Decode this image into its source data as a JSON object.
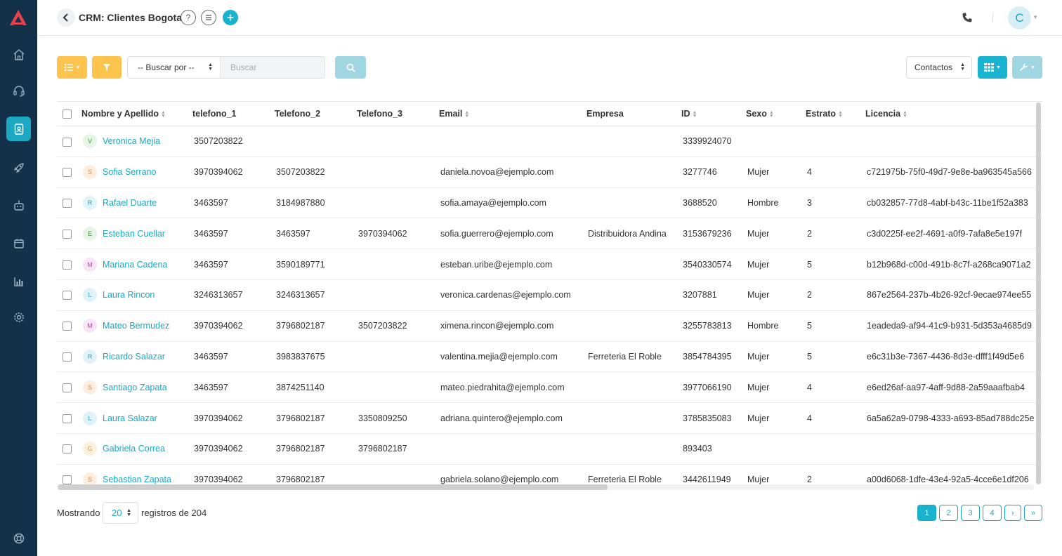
{
  "header": {
    "title": "CRM: Clientes Bogota",
    "help_icon": "?",
    "avatar_letter": "C"
  },
  "toolbar": {
    "search_by": "-- Buscar por --",
    "search_placeholder": "Buscar",
    "view_select": "Contactos"
  },
  "table": {
    "columns": [
      "Nombre y Apellido",
      "telefono_1",
      "Telefono_2",
      "Telefono_3",
      "Email",
      "Empresa",
      "ID",
      "Sexo",
      "Estrato",
      "Licencia"
    ],
    "rows": [
      {
        "initial": "V",
        "name": "Veronica Mejia",
        "t1": "3507203822",
        "t2": "",
        "t3": "",
        "email": "",
        "empresa": "",
        "id": "3339924070",
        "sexo": "",
        "estrato": "",
        "licencia": ""
      },
      {
        "initial": "S",
        "name": "Sofia Serrano",
        "t1": "3970394062",
        "t2": "3507203822",
        "t3": "",
        "email": "daniela.novoa@ejemplo.com",
        "empresa": "",
        "id": "3277746",
        "sexo": "Mujer",
        "estrato": "4",
        "licencia": "c721975b-75f0-49d7-9e8e-ba963545a566"
      },
      {
        "initial": "R",
        "name": "Rafael Duarte",
        "t1": "3463597",
        "t2": "3184987880",
        "t3": "",
        "email": "sofia.amaya@ejemplo.com",
        "empresa": "",
        "id": "3688520",
        "sexo": "Hombre",
        "estrato": "3",
        "licencia": "cb032857-77d8-4abf-b43c-11be1f52a383"
      },
      {
        "initial": "E",
        "name": "Esteban Cuellar",
        "t1": "3463597",
        "t2": "3463597",
        "t3": "3970394062",
        "email": "sofia.guerrero@ejemplo.com",
        "empresa": "Distribuidora Andina",
        "id": "3153679236",
        "sexo": "Mujer",
        "estrato": "2",
        "licencia": "c3d0225f-ee2f-4691-a0f9-7afa8e5e197f"
      },
      {
        "initial": "M",
        "name": "Mariana Cadena",
        "t1": "3463597",
        "t2": "3590189771",
        "t3": "",
        "email": "esteban.uribe@ejemplo.com",
        "empresa": "",
        "id": "3540330574",
        "sexo": "Mujer",
        "estrato": "5",
        "licencia": "b12b968d-c00d-491b-8c7f-a268ca9071a2"
      },
      {
        "initial": "L",
        "name": "Laura Rincon",
        "t1": "3246313657",
        "t2": "3246313657",
        "t3": "",
        "email": "veronica.cardenas@ejemplo.com",
        "empresa": "",
        "id": "3207881",
        "sexo": "Mujer",
        "estrato": "2",
        "licencia": "867e2564-237b-4b26-92cf-9ecae974ee55"
      },
      {
        "initial": "M",
        "name": "Mateo Bermudez",
        "t1": "3970394062",
        "t2": "3796802187",
        "t3": "3507203822",
        "email": "ximena.rincon@ejemplo.com",
        "empresa": "",
        "id": "3255783813",
        "sexo": "Hombre",
        "estrato": "5",
        "licencia": "1eadeda9-af94-41c9-b931-5d353a4685d9"
      },
      {
        "initial": "R",
        "name": "Ricardo Salazar",
        "t1": "3463597",
        "t2": "3983837675",
        "t3": "",
        "email": "valentina.mejia@ejemplo.com",
        "empresa": "Ferreteria El Roble",
        "id": "3854784395",
        "sexo": "Mujer",
        "estrato": "5",
        "licencia": "e6c31b3e-7367-4436-8d3e-dfff1f49d5e6"
      },
      {
        "initial": "S",
        "name": "Santiago Zapata",
        "t1": "3463597",
        "t2": "3874251140",
        "t3": "",
        "email": "mateo.piedrahita@ejemplo.com",
        "empresa": "",
        "id": "3977066190",
        "sexo": "Mujer",
        "estrato": "4",
        "licencia": "e6ed26af-aa97-4aff-9d88-2a59aaafbab4"
      },
      {
        "initial": "L",
        "name": "Laura Salazar",
        "t1": "3970394062",
        "t2": "3796802187",
        "t3": "3350809250",
        "email": "adriana.quintero@ejemplo.com",
        "empresa": "",
        "id": "3785835083",
        "sexo": "Mujer",
        "estrato": "4",
        "licencia": "6a5a62a9-0798-4333-a693-85ad788dc25e"
      },
      {
        "initial": "G",
        "name": "Gabriela Correa",
        "t1": "3970394062",
        "t2": "3796802187",
        "t3": "3796802187",
        "email": "",
        "empresa": "",
        "id": "893403",
        "sexo": "",
        "estrato": "",
        "licencia": ""
      },
      {
        "initial": "S",
        "name": "Sebastian Zapata",
        "t1": "3970394062",
        "t2": "3796802187",
        "t3": "",
        "email": "gabriela.solano@ejemplo.com",
        "empresa": "Ferreteria El Roble",
        "id": "3442611949",
        "sexo": "Mujer",
        "estrato": "2",
        "licencia": "a00d6068-1dfe-43e4-92a5-4cce6e1df206"
      }
    ]
  },
  "initial_colors": {
    "V": {
      "bg": "#e6f4e6",
      "fg": "#3a9a3a"
    },
    "S": {
      "bg": "#fdeee0",
      "fg": "#e08a3a"
    },
    "R": {
      "bg": "#e2f3f8",
      "fg": "#2aa0c0"
    },
    "E": {
      "bg": "#e6f4e6",
      "fg": "#3a9a3a"
    },
    "M": {
      "bg": "#f7e4f4",
      "fg": "#b34aa8"
    },
    "L": {
      "bg": "#e2f3f8",
      "fg": "#2aa0c0"
    },
    "G": {
      "bg": "#fdf0dd",
      "fg": "#d69a2a"
    }
  },
  "footer": {
    "showing_label": "Mostrando",
    "page_size": "20",
    "records_label": "registros de 204",
    "pages": [
      "1",
      "2",
      "3",
      "4"
    ],
    "next": "›",
    "last": "»"
  },
  "colors": {
    "sidebar": "#13324a",
    "accent": "#1ab3cf",
    "yellow": "#fcc44c"
  }
}
